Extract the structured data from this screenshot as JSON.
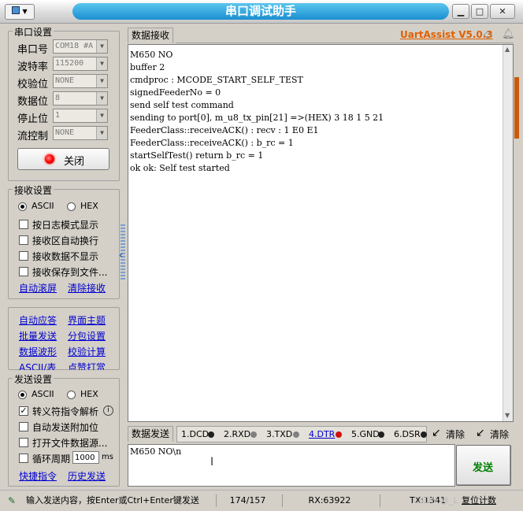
{
  "window": {
    "title": "串口调试助手",
    "min_label": "▁",
    "max_label": "□",
    "close_label": "✕",
    "sysmenu_label": "▼"
  },
  "serial_settings": {
    "group_label": "串口设置",
    "rows": [
      {
        "label": "串口号",
        "value": "COM18 #A"
      },
      {
        "label": "波特率",
        "value": "115200"
      },
      {
        "label": "校验位",
        "value": "NONE"
      },
      {
        "label": "数据位",
        "value": "8"
      },
      {
        "label": "停止位",
        "value": "1"
      },
      {
        "label": "流控制",
        "value": "NONE"
      }
    ],
    "close_button": "关闭"
  },
  "receive_settings": {
    "group_label": "接收设置",
    "ascii": "ASCII",
    "hex": "HEX",
    "options": [
      "按日志模式显示",
      "接收区自动换行",
      "接收数据不显示",
      "接收保存到文件..."
    ],
    "link_autoscroll": "自动滚屏",
    "link_clear": "清除接收"
  },
  "tools": {
    "items": [
      "自动应答",
      "界面主题",
      "批量发送",
      "分包设置",
      "数据波形",
      "校验计算",
      "ASCII/表",
      "点赞打赏"
    ]
  },
  "send_settings": {
    "group_label": "发送设置",
    "ascii": "ASCII",
    "hex": "HEX",
    "opt_escape": "转义符指令解析",
    "opt_append": "自动发送附加位",
    "opt_file": "打开文件数据源...",
    "opt_cycle": "循环周期",
    "cycle_value": "1000",
    "cycle_unit": "ms",
    "link_shortcut": "快捷指令",
    "link_history": "历史发送"
  },
  "receive": {
    "tab": "数据接收",
    "brand": "UartAssist V5.0.3",
    "lines": [
      "M650 NO",
      "buffer 2",
      "cmdproc : MCODE_START_SELF_TEST",
      "signedFeederNo = 0",
      "send self test command",
      "sending to port[0], m_u8_tx_pin[21] =>(HEX) 3 18 1 5 21",
      "FeederClass::receiveACK() : recv : 1 E0 E1",
      "FeederClass::receiveACK() : b_rc = 1",
      "startSelfTest() return b_rc = 1",
      "ok ok: Self test started"
    ]
  },
  "send": {
    "tab": "数据发送",
    "pins": [
      {
        "label": "1.DCD",
        "color": "#202020"
      },
      {
        "label": "2.RXD",
        "color": "#808080"
      },
      {
        "label": "3.TXD",
        "color": "#808080"
      },
      {
        "label": "4.DTR",
        "color": "#d01010"
      },
      {
        "label": "5.GND",
        "color": "#202020"
      },
      {
        "label": "6.DSR",
        "color": "#202020"
      }
    ],
    "clear1": "清除",
    "clear2": "清除",
    "input_value": "M650 NO\\n",
    "send_button": "发送"
  },
  "status": {
    "hint": "输入发送内容，按Enter或Ctrl+Enter键发送",
    "count": "174/157",
    "rx": "RX:63922",
    "tx": "TX:1341",
    "reset": "复位计数",
    "watermark": "CSDN @_L"
  },
  "colors": {
    "title_pill": "#1a8fd0",
    "brand": "#e06000",
    "link": "#0000d0",
    "send_button_text": "#008000",
    "led_red": "#ff0000"
  }
}
